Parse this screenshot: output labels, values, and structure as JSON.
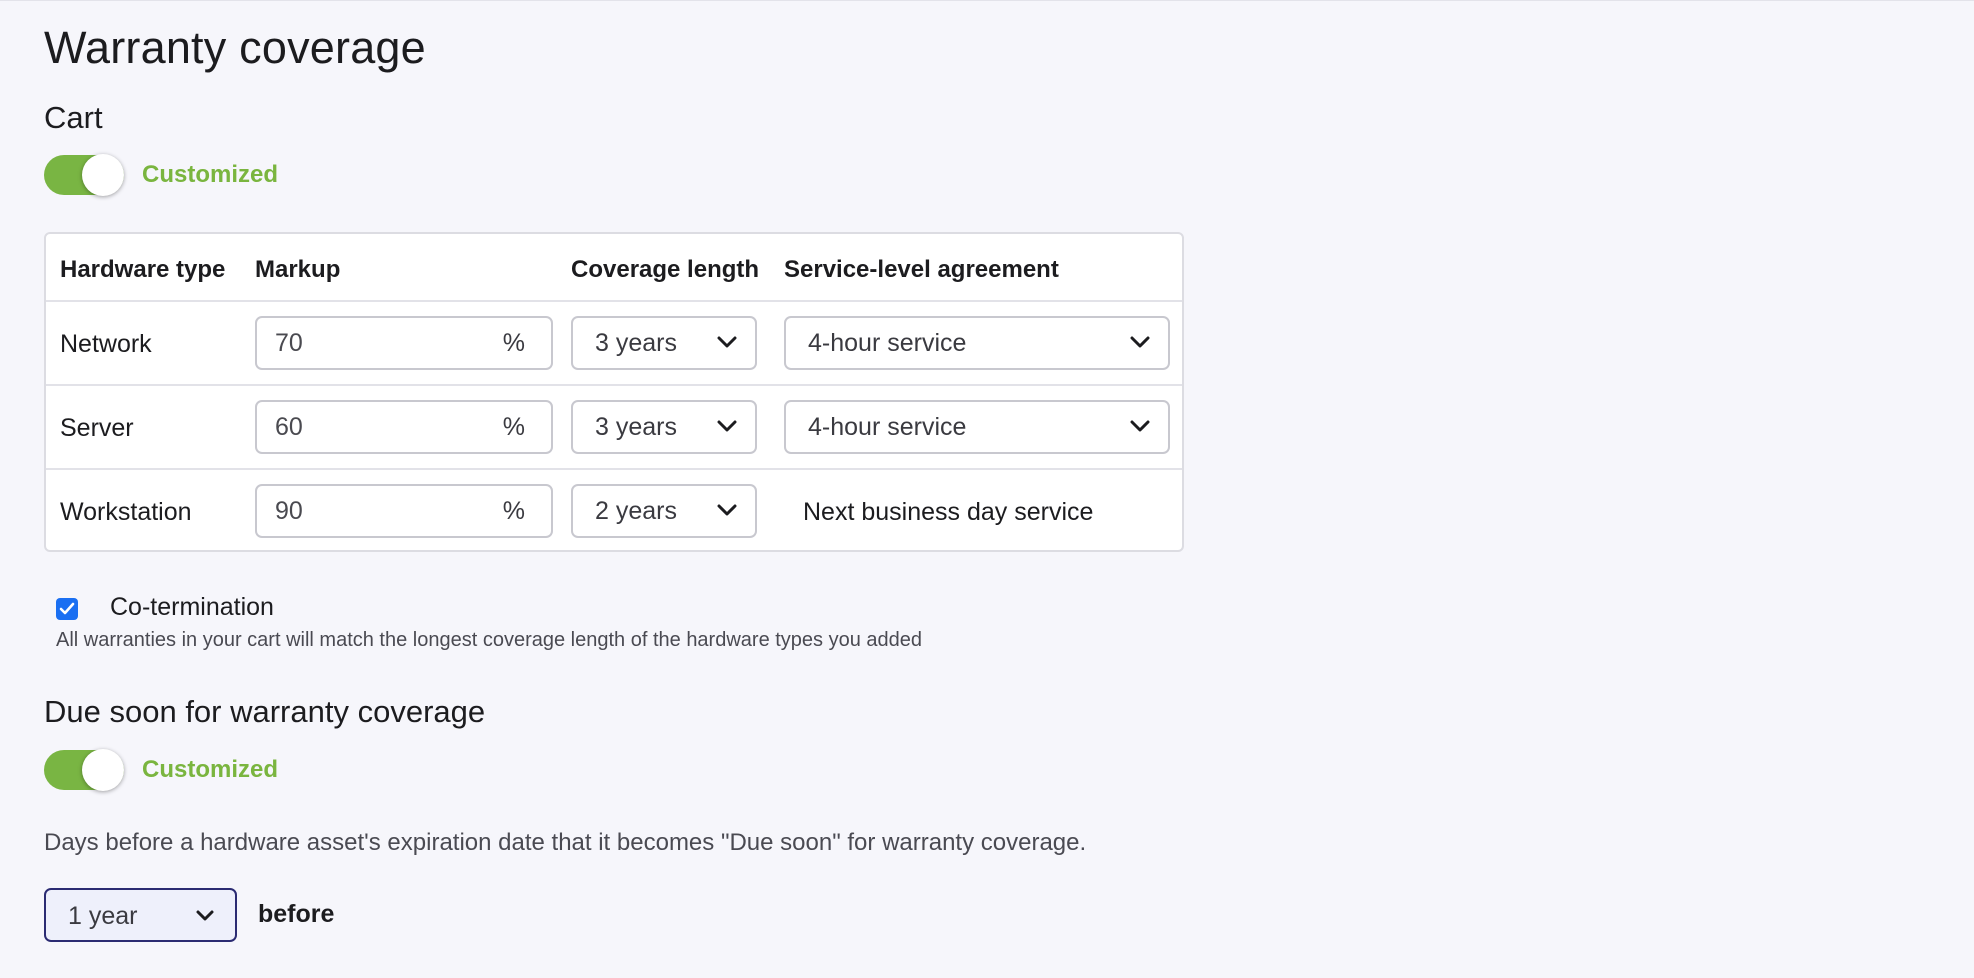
{
  "page": {
    "title": "Warranty coverage",
    "background_color": "#f6f6fb"
  },
  "cart": {
    "title": "Cart",
    "toggle": {
      "on": true,
      "label": "Customized",
      "color": "#79b543"
    },
    "table": {
      "headers": [
        "Hardware type",
        "Markup",
        "Coverage length",
        "Service-level agreement"
      ],
      "rows": [
        {
          "hardware_type": "Network",
          "markup": "70",
          "markup_suffix": "%",
          "coverage_length": "3 years",
          "sla": "4-hour service",
          "sla_is_select": true
        },
        {
          "hardware_type": "Server",
          "markup": "60",
          "markup_suffix": "%",
          "coverage_length": "3 years",
          "sla": "4-hour service",
          "sla_is_select": true
        },
        {
          "hardware_type": "Workstation",
          "markup": "90",
          "markup_suffix": "%",
          "coverage_length": "2 years",
          "sla": "Next business day service",
          "sla_is_select": false
        }
      ]
    },
    "cotermination": {
      "checked": true,
      "label": "Co-termination",
      "help": "All warranties in your cart will match the longest coverage length of the hardware types you added",
      "checkbox_color": "#1a6ff2"
    }
  },
  "due_soon": {
    "title": "Due soon for warranty coverage",
    "toggle": {
      "on": true,
      "label": "Customized"
    },
    "description": "Days before a hardware asset's expiration date that it becomes \"Due soon\" for warranty coverage.",
    "select_value": "1 year",
    "after_label": "before"
  },
  "icons": {
    "dropdown": "chevron-down-icon",
    "checkbox": "checkmark-icon"
  }
}
